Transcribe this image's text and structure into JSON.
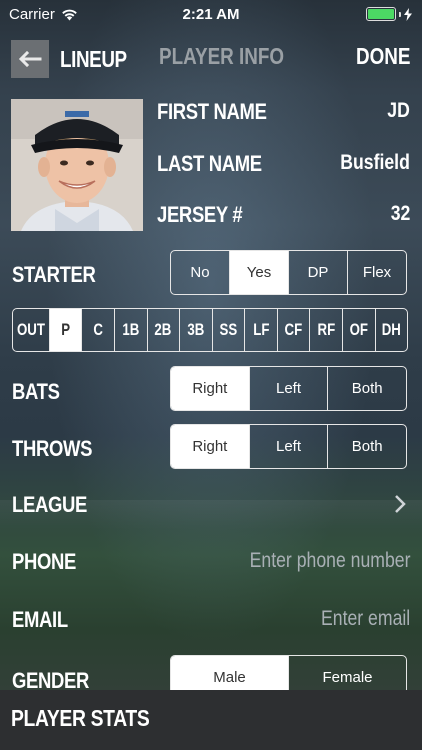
{
  "status_bar": {
    "carrier": "Carrier",
    "time": "2:21 AM",
    "battery_color": "#4cd964"
  },
  "nav": {
    "back_icon": "arrow-left-icon",
    "back_label": "LINEUP",
    "title": "PLAYER INFO",
    "done_label": "DONE"
  },
  "player": {
    "first_name_label": "FIRST NAME",
    "first_name": "JD",
    "last_name_label": "LAST NAME",
    "last_name": "Busfield",
    "jersey_label": "JERSEY #",
    "jersey": "32"
  },
  "starter": {
    "label": "STARTER",
    "options": [
      "No",
      "Yes",
      "DP",
      "Flex"
    ],
    "selected": "Yes"
  },
  "positions": {
    "options": [
      "OUT",
      "P",
      "C",
      "1B",
      "2B",
      "3B",
      "SS",
      "LF",
      "CF",
      "RF",
      "OF",
      "DH"
    ],
    "selected": "P"
  },
  "bats": {
    "label": "BATS",
    "options": [
      "Right",
      "Left",
      "Both"
    ],
    "selected": "Right"
  },
  "throws": {
    "label": "THROWS",
    "options": [
      "Right",
      "Left",
      "Both"
    ],
    "selected": "Right"
  },
  "league": {
    "label": "LEAGUE",
    "icon": "chevron-right-icon"
  },
  "phone": {
    "label": "PHONE",
    "placeholder": "Enter phone number"
  },
  "email": {
    "label": "EMAIL",
    "placeholder": "Enter email"
  },
  "gender": {
    "label": "GENDER",
    "options": [
      "Male",
      "Female"
    ],
    "selected": "Male"
  },
  "footer": {
    "label": "PLAYER STATS"
  }
}
